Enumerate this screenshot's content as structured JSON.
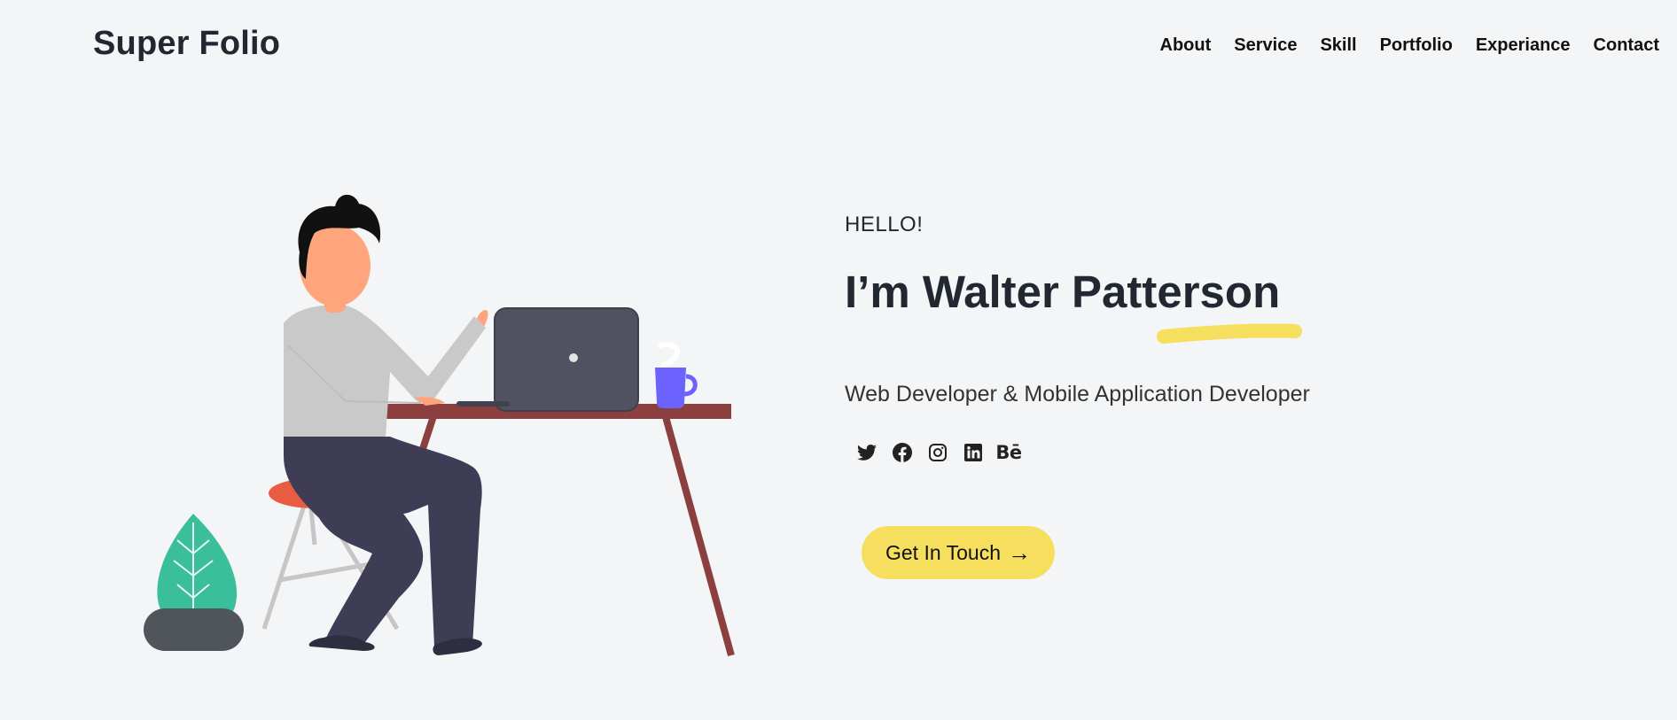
{
  "brand": {
    "name": "Super Folio"
  },
  "nav": {
    "items": [
      {
        "label": "About"
      },
      {
        "label": "Service"
      },
      {
        "label": "Skill"
      },
      {
        "label": "Portfolio"
      },
      {
        "label": "Experiance"
      },
      {
        "label": "Contact"
      }
    ]
  },
  "hero": {
    "greeting": "HELLO!",
    "name": "I’m Walter Patterson",
    "role": "Web Developer & Mobile Application Developer",
    "cta_label": "Get In Touch",
    "cta_icon": "arrow-right-icon",
    "illustration": "person-at-desk-with-laptop"
  },
  "social": [
    {
      "name": "twitter-icon"
    },
    {
      "name": "facebook-icon"
    },
    {
      "name": "instagram-icon"
    },
    {
      "name": "linkedin-icon"
    },
    {
      "name": "behance-icon",
      "label": "Bē"
    }
  ],
  "colors": {
    "background": "#f4f5f7",
    "accent_yellow": "#f6df5f",
    "text_dark": "#222831",
    "desk": "#8b3f3f",
    "plant": "#3bbf9a",
    "mug": "#6c63ff",
    "chair_seat": "#e85c41",
    "laptop": "#50525f",
    "pants": "#3f3d56"
  }
}
